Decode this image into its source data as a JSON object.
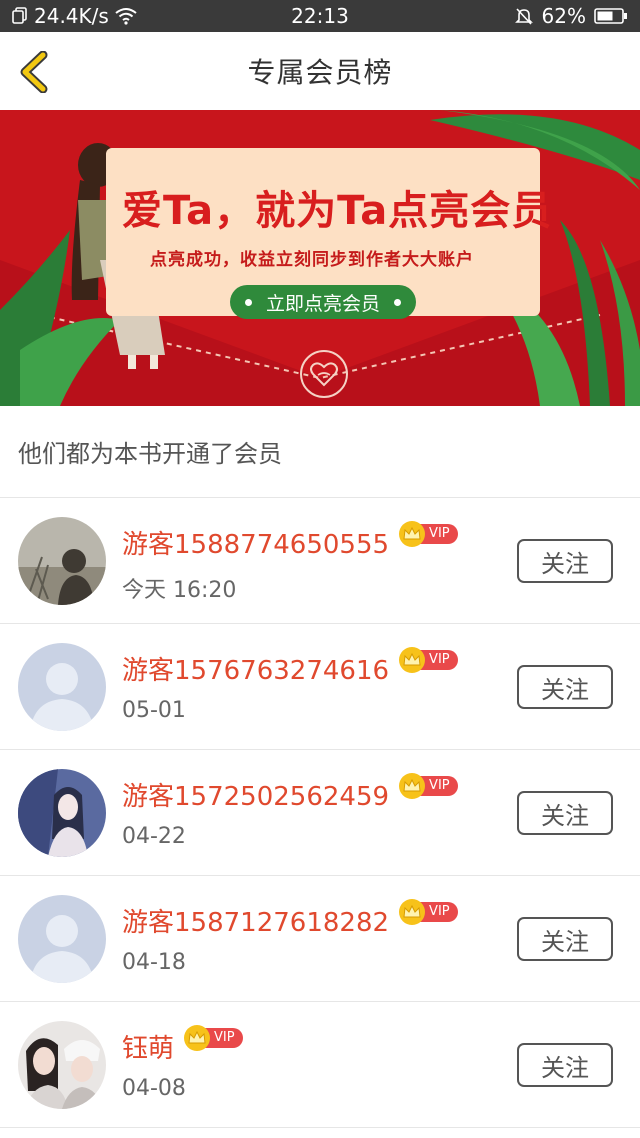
{
  "status_bar": {
    "network_speed": "24.4K/s",
    "time": "22:13",
    "battery": "62%",
    "icons": [
      "copy-icon",
      "wifi-icon",
      "mute-icon",
      "battery-icon"
    ]
  },
  "nav": {
    "title": "专属会员榜",
    "back_icon": "chevron-left-icon"
  },
  "banner": {
    "headline": "爱Ta，就为Ta点亮会员",
    "subtext": "点亮成功，收益立刻同步到作者大大账户",
    "cta": "立即点亮会员",
    "emblem_icon": "heart-hands-icon"
  },
  "section": {
    "label": "他们都为本书开通了会员"
  },
  "members": [
    {
      "name": "游客1588774650555",
      "badge": "VIP",
      "date": "今天 16:20",
      "follow": "关注",
      "avatar": "photo-avatar"
    },
    {
      "name": "游客1576763274616",
      "badge": "VIP",
      "date": "05-01",
      "follow": "关注",
      "avatar": "default-avatar"
    },
    {
      "name": "游客1572502562459",
      "badge": "VIP",
      "date": "04-22",
      "follow": "关注",
      "avatar": "photo-avatar"
    },
    {
      "name": "游客1587127618282",
      "badge": "VIP",
      "date": "04-18",
      "follow": "关注",
      "avatar": "default-avatar"
    },
    {
      "name": "钰萌",
      "badge": "VIP",
      "date": "04-08",
      "follow": "关注",
      "avatar": "photo-avatar"
    }
  ],
  "colors": {
    "accent_name": "#e0492e",
    "banner_red": "#c8151c",
    "vip_tag": "#e9494a",
    "crown": "#f7c21a",
    "back_chevron": "#f2c811",
    "cta_green": "#2f8a3b"
  }
}
